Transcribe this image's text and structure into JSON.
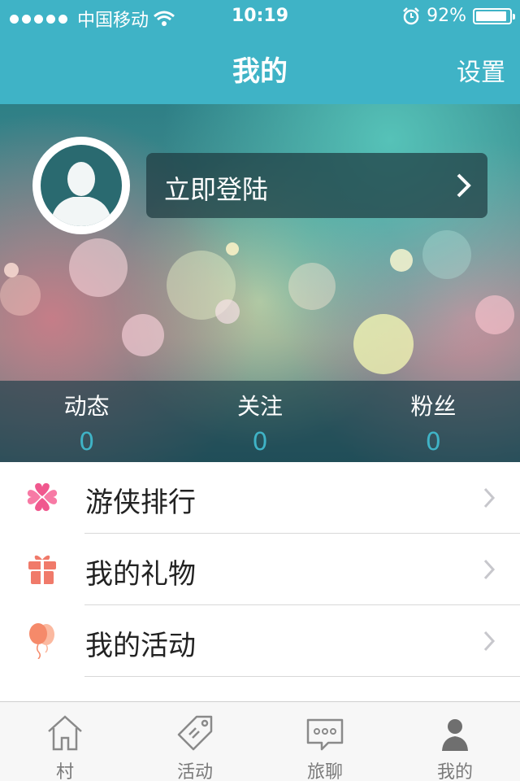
{
  "status_bar": {
    "carrier": "中国移动",
    "time": "10:19",
    "battery": "92%",
    "battery_level": 0.92
  },
  "nav": {
    "title": "我的",
    "settings_label": "设置"
  },
  "profile": {
    "login_label": "立即登陆"
  },
  "stats": [
    {
      "label": "动态",
      "value": "0"
    },
    {
      "label": "关注",
      "value": "0"
    },
    {
      "label": "粉丝",
      "value": "0"
    }
  ],
  "menu": [
    {
      "label": "游侠排行",
      "icon": "clover-hearts-icon"
    },
    {
      "label": "我的礼物",
      "icon": "gift-icon"
    },
    {
      "label": "我的活动",
      "icon": "balloons-icon"
    }
  ],
  "tabs": [
    {
      "label": "村",
      "icon": "house-icon"
    },
    {
      "label": "活动",
      "icon": "tag-icon"
    },
    {
      "label": "旅聊",
      "icon": "chat-icon"
    },
    {
      "label": "我的",
      "icon": "person-icon"
    }
  ],
  "colors": {
    "accent": "#3fb3c6",
    "stat_value": "#3fb3c6"
  }
}
